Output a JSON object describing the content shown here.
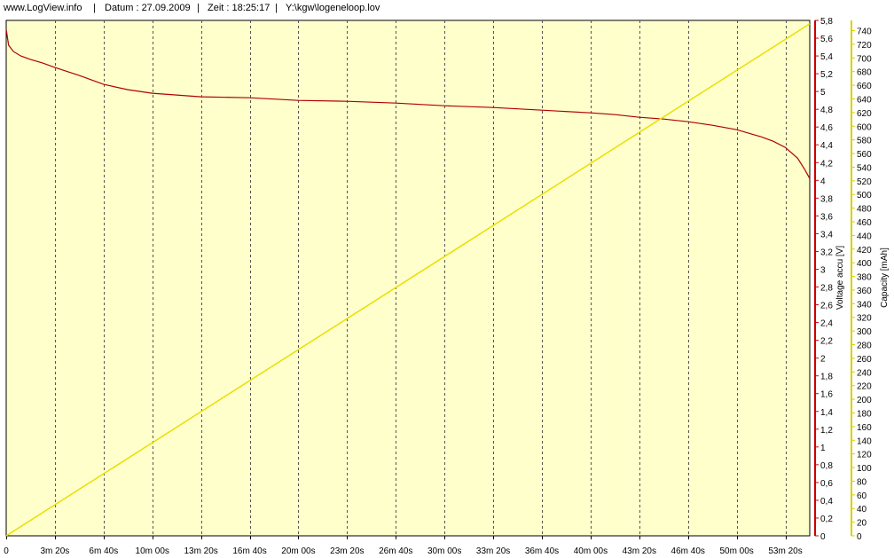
{
  "header": {
    "site": "www.LogView.info",
    "sep": "|",
    "datum": "Datum : 27.09.2009",
    "zeit": "Zeit : 18:25:17",
    "file": "Y:\\kgw\\logeneloop.lov"
  },
  "colors": {
    "plot_bg": "#ffffcc",
    "voltage": "#b00000",
    "capacity": "#e8e000",
    "grid": "#555555",
    "voltage_axis": "#cc0000",
    "capacity_axis": "#d8d000"
  },
  "chart_data": {
    "type": "line",
    "x_unit": "s",
    "x_range": [
      0,
      3300
    ],
    "x_ticks": [
      {
        "value": 0,
        "label": "0"
      },
      {
        "value": 200,
        "label": "3m 20s"
      },
      {
        "value": 400,
        "label": "6m 40s"
      },
      {
        "value": 600,
        "label": "10m 00s"
      },
      {
        "value": 800,
        "label": "13m 20s"
      },
      {
        "value": 1000,
        "label": "16m 40s"
      },
      {
        "value": 1200,
        "label": "20m 00s"
      },
      {
        "value": 1400,
        "label": "23m 20s"
      },
      {
        "value": 1600,
        "label": "26m 40s"
      },
      {
        "value": 1800,
        "label": "30m 00s"
      },
      {
        "value": 2000,
        "label": "33m 20s"
      },
      {
        "value": 2200,
        "label": "36m 40s"
      },
      {
        "value": 2400,
        "label": "40m 00s"
      },
      {
        "value": 2600,
        "label": "43m 20s"
      },
      {
        "value": 2800,
        "label": "46m 40s"
      },
      {
        "value": 3000,
        "label": "50m 00s"
      },
      {
        "value": 3200,
        "label": "53m 20s"
      }
    ],
    "y_left": {
      "label": "Voltage accu [V]",
      "ylim": [
        0,
        5.8
      ],
      "ticks": [
        "0",
        "0,2",
        "0,4",
        "0,6",
        "0,8",
        "1",
        "1,2",
        "1,4",
        "1,6",
        "1,8",
        "2",
        "2,2",
        "2,4",
        "2,6",
        "2,8",
        "3",
        "3,2",
        "3,4",
        "3,6",
        "3,8",
        "4",
        "4,2",
        "4,4",
        "4,6",
        "4,8",
        "5",
        "5,2",
        "5,4",
        "5,6",
        "5,8"
      ]
    },
    "y_right": {
      "label": "Capacity [mAh]",
      "ylim": [
        0,
        755
      ],
      "ticks": [
        "0",
        "20",
        "40",
        "60",
        "80",
        "100",
        "120",
        "140",
        "160",
        "180",
        "200",
        "220",
        "240",
        "260",
        "280",
        "300",
        "320",
        "340",
        "360",
        "380",
        "400",
        "420",
        "440",
        "460",
        "480",
        "500",
        "520",
        "540",
        "560",
        "580",
        "600",
        "620",
        "640",
        "660",
        "680",
        "700",
        "720",
        "740"
      ]
    },
    "grid": "vertical dashed",
    "series": [
      {
        "name": "Voltage accu [V]",
        "axis": "left",
        "x": [
          0,
          10,
          30,
          60,
          100,
          150,
          200,
          300,
          400,
          500,
          600,
          700,
          800,
          1000,
          1200,
          1400,
          1600,
          1800,
          2000,
          2200,
          2400,
          2500,
          2600,
          2700,
          2800,
          2900,
          3000,
          3100,
          3150,
          3200,
          3250,
          3280,
          3300
        ],
        "values": [
          5.7,
          5.52,
          5.45,
          5.4,
          5.36,
          5.32,
          5.27,
          5.18,
          5.08,
          5.02,
          4.98,
          4.96,
          4.94,
          4.93,
          4.9,
          4.89,
          4.87,
          4.84,
          4.82,
          4.79,
          4.76,
          4.74,
          4.71,
          4.69,
          4.66,
          4.62,
          4.57,
          4.49,
          4.44,
          4.37,
          4.25,
          4.12,
          4.02
        ]
      },
      {
        "name": "Capacity [mAh]",
        "axis": "right",
        "x": [
          0,
          3300
        ],
        "values": [
          0,
          750
        ]
      }
    ]
  }
}
